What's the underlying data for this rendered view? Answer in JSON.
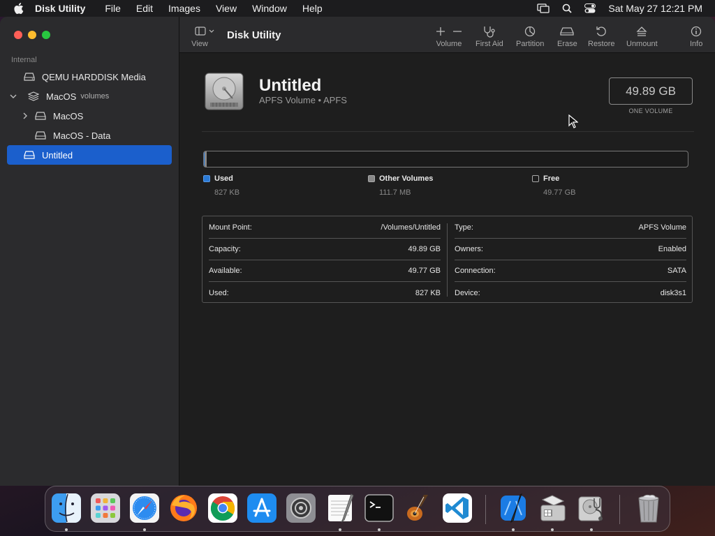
{
  "menubar": {
    "app_name": "Disk Utility",
    "items": [
      "File",
      "Edit",
      "Images",
      "View",
      "Window",
      "Help"
    ],
    "clock": "Sat May 27  12:21 PM"
  },
  "sidebar": {
    "section": "Internal",
    "items": [
      {
        "label": "QEMU HARDDISK Media"
      },
      {
        "label": "MacOS",
        "sub": "volumes"
      },
      {
        "label": "MacOS"
      },
      {
        "label": "MacOS - Data"
      },
      {
        "label": "Untitled"
      }
    ]
  },
  "toolbar": {
    "view_label": "View",
    "title": "Disk Utility",
    "buttons": {
      "volume": "Volume",
      "first_aid": "First Aid",
      "partition": "Partition",
      "erase": "Erase",
      "restore": "Restore",
      "unmount": "Unmount",
      "info": "Info"
    }
  },
  "volume": {
    "name": "Untitled",
    "type_line": "APFS Volume • APFS",
    "capacity": "49.89 GB",
    "capacity_sub": "ONE VOLUME"
  },
  "usage": {
    "used_fraction": 0.002,
    "other_fraction": 0.004,
    "colors": {
      "used": "#2a7ad6",
      "other": "#888888",
      "free": "#1a1a1a"
    },
    "legend": [
      {
        "name": "Used",
        "value": "827 KB"
      },
      {
        "name": "Other Volumes",
        "value": "111.7 MB"
      },
      {
        "name": "Free",
        "value": "49.77 GB"
      }
    ]
  },
  "info": {
    "left": [
      {
        "label": "Mount Point:",
        "value": "/Volumes/Untitled"
      },
      {
        "label": "Capacity:",
        "value": "49.89 GB"
      },
      {
        "label": "Available:",
        "value": "49.77 GB"
      },
      {
        "label": "Used:",
        "value": "827 KB"
      }
    ],
    "right": [
      {
        "label": "Type:",
        "value": "APFS Volume"
      },
      {
        "label": "Owners:",
        "value": "Enabled"
      },
      {
        "label": "Connection:",
        "value": "SATA"
      },
      {
        "label": "Device:",
        "value": "disk3s1"
      }
    ]
  },
  "dock": {
    "apps": [
      "finder-icon",
      "launchpad-icon",
      "safari-icon",
      "firefox-icon",
      "chrome-icon",
      "app-store-icon",
      "system-settings-icon",
      "textedit-icon",
      "terminal-icon",
      "garageband-icon",
      "vscode-icon",
      "xcode-icon",
      "boot-camp-icon",
      "disk-utility-icon",
      "trash-icon"
    ]
  }
}
